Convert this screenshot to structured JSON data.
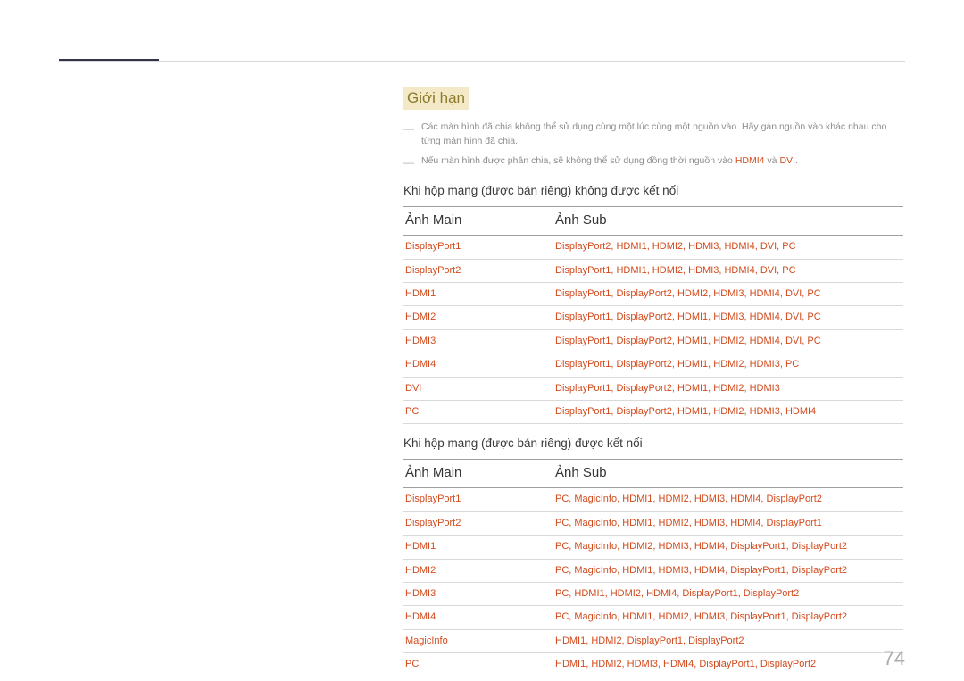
{
  "page_number": "74",
  "section_title": "Giới hạn",
  "notes": {
    "n1": "Các màn hình đã chia không thể sử dụng cùng một lúc cùng một nguồn vào. Hãy gán nguồn vào khác nhau cho từng màn hình đã chia.",
    "n2_pre": "Nếu màn hình được phân chia, sẽ không thể sử dụng đồng thời nguồn vào ",
    "n2_red1": "HDMI4",
    "n2_mid": " và ",
    "n2_red2": "DVI",
    "n2_post": "."
  },
  "table1": {
    "caption": "Khi hộp mạng (được bán riêng) không được kết nối",
    "head_main": "Ảnh Main",
    "head_sub": "Ảnh Sub",
    "rows": [
      {
        "main": "DisplayPort1",
        "sub": "DisplayPort2, HDMI1, HDMI2, HDMI3, HDMI4, DVI, PC"
      },
      {
        "main": "DisplayPort2",
        "sub": "DisplayPort1, HDMI1, HDMI2, HDMI3, HDMI4, DVI, PC"
      },
      {
        "main": "HDMI1",
        "sub": "DisplayPort1, DisplayPort2, HDMI2, HDMI3, HDMI4, DVI, PC"
      },
      {
        "main": "HDMI2",
        "sub": "DisplayPort1, DisplayPort2, HDMI1, HDMI3, HDMI4, DVI, PC"
      },
      {
        "main": "HDMI3",
        "sub": "DisplayPort1, DisplayPort2, HDMI1, HDMI2, HDMI4, DVI, PC"
      },
      {
        "main": "HDMI4",
        "sub": "DisplayPort1, DisplayPort2, HDMI1, HDMI2, HDMI3, PC"
      },
      {
        "main": "DVI",
        "sub": "DisplayPort1, DisplayPort2, HDMI1, HDMI2, HDMI3"
      },
      {
        "main": "PC",
        "sub": "DisplayPort1, DisplayPort2, HDMI1, HDMI2, HDMI3, HDMI4"
      }
    ]
  },
  "table2": {
    "caption": "Khi hộp mạng (được bán riêng) được kết nối",
    "head_main": "Ảnh Main",
    "head_sub": "Ảnh Sub",
    "rows": [
      {
        "main": "DisplayPort1",
        "sub": "PC, MagicInfo, HDMI1, HDMI2, HDMI3, HDMI4, DisplayPort2"
      },
      {
        "main": "DisplayPort2",
        "sub": "PC, MagicInfo, HDMI1, HDMI2, HDMI3, HDMI4, DisplayPort1"
      },
      {
        "main": "HDMI1",
        "sub": "PC, MagicInfo, HDMI2, HDMI3, HDMI4, DisplayPort1, DisplayPort2"
      },
      {
        "main": "HDMI2",
        "sub": "PC, MagicInfo, HDMI1, HDMI3, HDMI4, DisplayPort1, DisplayPort2"
      },
      {
        "main": "HDMI3",
        "sub": "PC, HDMI1, HDMI2, HDMI4, DisplayPort1, DisplayPort2"
      },
      {
        "main": "HDMI4",
        "sub": "PC, MagicInfo, HDMI1, HDMI2, HDMI3, DisplayPort1, DisplayPort2"
      },
      {
        "main": "MagicInfo",
        "sub": "HDMI1, HDMI2, DisplayPort1, DisplayPort2"
      },
      {
        "main": "PC",
        "sub": "HDMI1, HDMI2, HDMI3, HDMI4, DisplayPort1, DisplayPort2"
      }
    ]
  }
}
